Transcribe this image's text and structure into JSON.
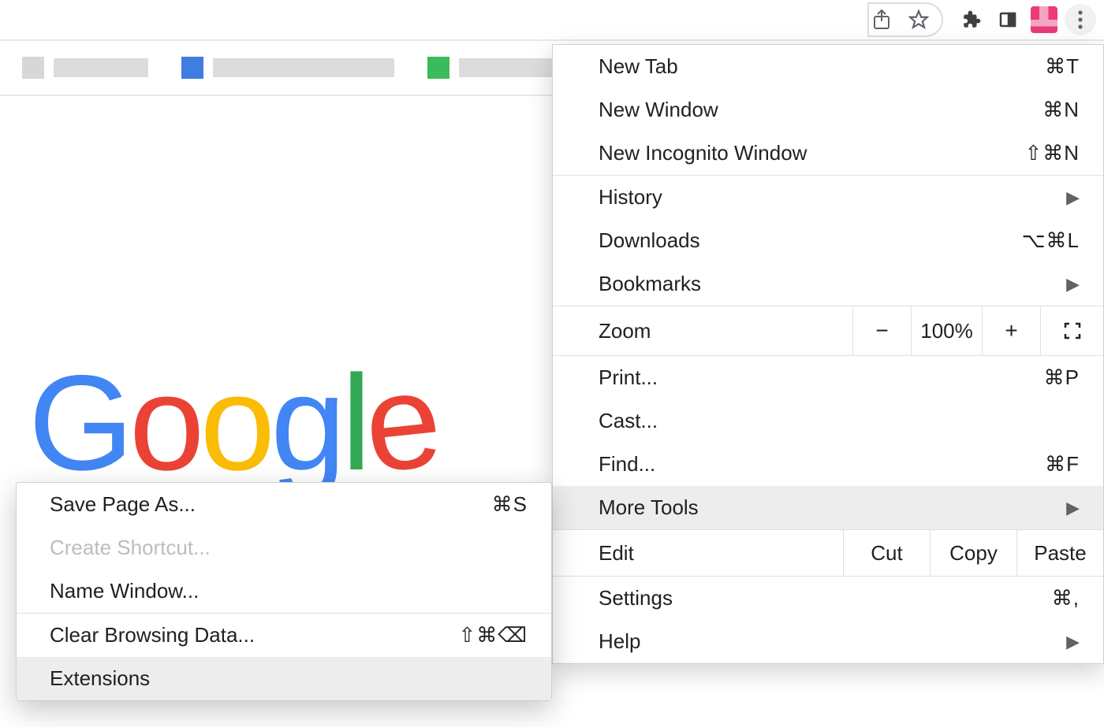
{
  "toolbar": {
    "share_tooltip": "Share",
    "bookmark_tooltip": "Bookmark",
    "extensions_tooltip": "Extensions",
    "sidepanel_tooltip": "Side panel",
    "profile_tooltip": "Profile",
    "menu_tooltip": "Customize and control Google Chrome"
  },
  "page": {
    "logo_text": "Google"
  },
  "menu": {
    "new_tab": {
      "label": "New Tab",
      "shortcut": "⌘T"
    },
    "new_window": {
      "label": "New Window",
      "shortcut": "⌘N"
    },
    "new_incognito": {
      "label": "New Incognito Window",
      "shortcut": "⇧⌘N"
    },
    "history": {
      "label": "History"
    },
    "downloads": {
      "label": "Downloads",
      "shortcut": "⌥⌘L"
    },
    "bookmarks": {
      "label": "Bookmarks"
    },
    "zoom": {
      "label": "Zoom",
      "value": "100%",
      "minus": "−",
      "plus": "+"
    },
    "print": {
      "label": "Print...",
      "shortcut": "⌘P"
    },
    "cast": {
      "label": "Cast..."
    },
    "find": {
      "label": "Find...",
      "shortcut": "⌘F"
    },
    "more_tools": {
      "label": "More Tools"
    },
    "edit": {
      "label": "Edit",
      "cut": "Cut",
      "copy": "Copy",
      "paste": "Paste"
    },
    "settings": {
      "label": "Settings",
      "shortcut": "⌘,"
    },
    "help": {
      "label": "Help"
    }
  },
  "submenu": {
    "save_page": {
      "label": "Save Page As...",
      "shortcut": "⌘S"
    },
    "create_shortcut": {
      "label": "Create Shortcut..."
    },
    "name_window": {
      "label": "Name Window..."
    },
    "clear_browsing": {
      "label": "Clear Browsing Data...",
      "shortcut": "⇧⌘⌫"
    },
    "extensions": {
      "label": "Extensions"
    }
  }
}
